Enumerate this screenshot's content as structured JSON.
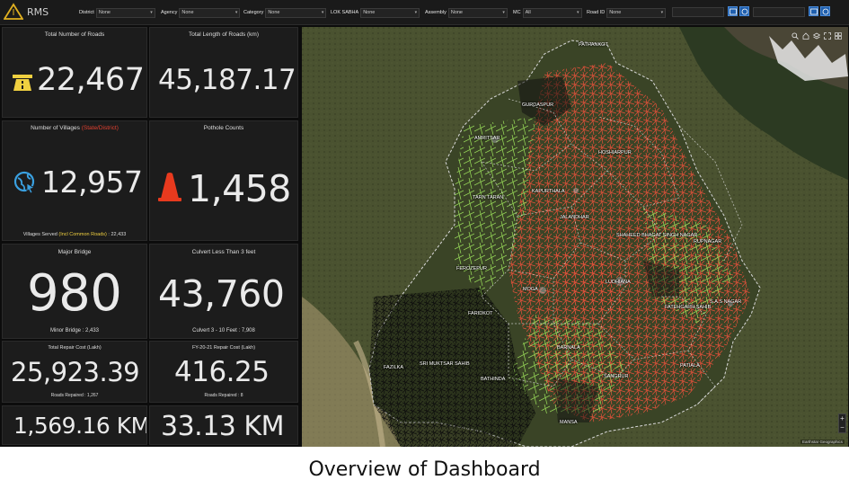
{
  "app": {
    "title": "RMS"
  },
  "filters": [
    {
      "label": "District",
      "value": "None"
    },
    {
      "label": "Agency",
      "value": "None"
    },
    {
      "label": "Category",
      "value": "None"
    },
    {
      "label": "LOK SABHA",
      "value": "None"
    },
    {
      "label": "Assembly",
      "value": "None"
    },
    {
      "label": "MC",
      "value": "All"
    },
    {
      "label": "Road ID",
      "value": "None"
    }
  ],
  "stats": {
    "roads": {
      "title": "Total Number of Roads",
      "value": "22,467"
    },
    "length": {
      "title": "Total Length of Roads (km)",
      "value": "45,187.17"
    },
    "villages": {
      "title": "Number of Villages",
      "title_note": "(State/District)",
      "value": "12,957",
      "sub_prefix": "Villages Served",
      "sub_note": "(Incl Common Roads)",
      "sub_value": ": 22,433"
    },
    "potholes": {
      "title": "Pothole Counts",
      "value": "1,458"
    },
    "major_bridge": {
      "title": "Major Bridge",
      "value": "980",
      "sub": "Minor Bridge : 2,433"
    },
    "culvert": {
      "title": "Culvert Less Than 3 feet",
      "value": "43,760",
      "sub": "Culvert 3 - 10 Feet : 7,908"
    },
    "repair_cost": {
      "title": "Total Repair Cost (Lakh)",
      "value": "25,923.39",
      "sub": "Roads Repaired : 1,267"
    },
    "fy_repair_cost": {
      "title": "FY-20-21 Repair Cost (Lakh)",
      "value": "416.25",
      "sub": "Roads Repaired : 8"
    },
    "km_total": {
      "value": "1,569.16 KM"
    },
    "km_fy": {
      "value": "33.13 KM"
    }
  },
  "map": {
    "labels": [
      "PATHANKOT",
      "GURDASPUR",
      "AMRITSAR",
      "HOSHIARPUR",
      "KAPURTHALA",
      "TARN TARAN",
      "JALANDHAR",
      "SHAHEED BHAGAT SINGH NAGAR",
      "RUPNAGAR",
      "FEROZEPUR",
      "MOGA",
      "LUDHIANA",
      "FATEHGARH SAHIB",
      "S.A.S NAGAR",
      "FARIDKOT",
      "BARNALA",
      "FAZILKA",
      "SRI MUKTSAR SAHIB",
      "BATHINDA",
      "SANGRUR",
      "PATIALA",
      "MANSA"
    ],
    "controls": [
      "search-icon",
      "home-icon",
      "layers-icon",
      "expand-icon",
      "grid-icon"
    ],
    "zoom_in": "+",
    "zoom_out": "−",
    "attribution": "Earthstar Geographics"
  },
  "caption": "Overview of Dashboard",
  "colors": {
    "accent": "#1f5fae",
    "road_red": "#e8503a",
    "road_green": "#9be05a",
    "cone": "#e83a1e",
    "icon_blue": "#3aa0e0"
  }
}
